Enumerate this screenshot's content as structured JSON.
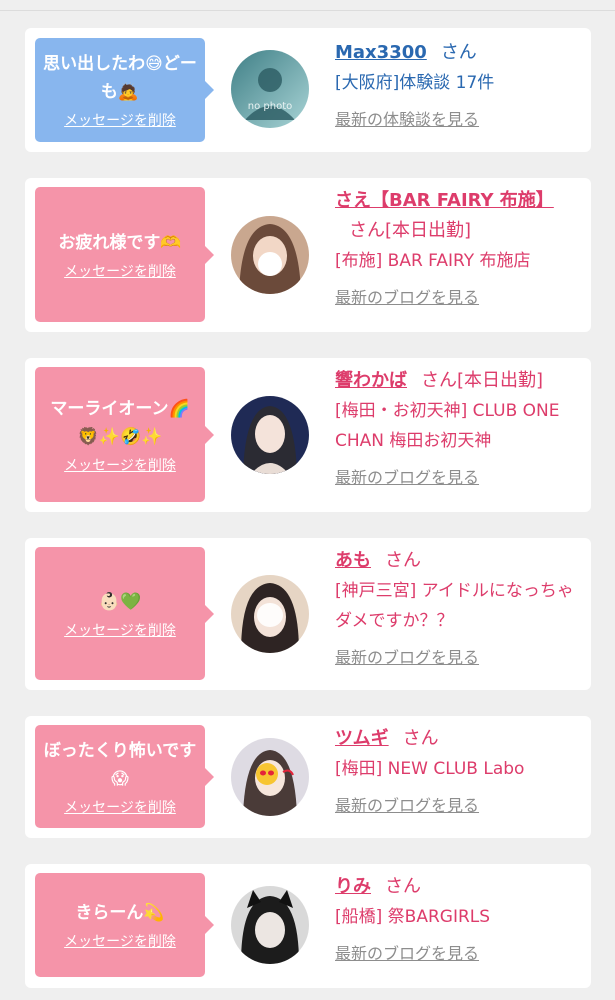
{
  "delete_label": "メッセージを削除",
  "cards": [
    {
      "message": "思い出したわ😅どーも🙇",
      "bubble_color": "#88b6ee",
      "name": "Max3300",
      "san": "さん",
      "status": "",
      "sub": "[大阪府]体験談 17件",
      "link": "最新の体験談を見る",
      "avatar_text": "no photo"
    },
    {
      "message": "お疲れ様です🫶",
      "bubble_color": "#f594a9",
      "name": "さえ【BAR FAIRY 布施】",
      "san": "さん",
      "status": "[本日出勤]",
      "sub": "[布施] BAR FAIRY 布施店",
      "link": "最新のブログを見る"
    },
    {
      "message": "マーライオーン🌈🦁✨🤣✨",
      "bubble_color": "#f594a9",
      "name": "響わかば",
      "san": "さん",
      "status": "[本日出勤]",
      "sub": "[梅田・お初天神] CLUB ONE CHAN 梅田お初天神",
      "link": "最新のブログを見る"
    },
    {
      "message": "👶🏻💚",
      "bubble_color": "#f594a9",
      "name": "あも",
      "san": "さん",
      "status": "",
      "sub": "[神戸三宮] アイドルになっちゃダメですか？？",
      "link": "最新のブログを見る"
    },
    {
      "message": "ぼったくり怖いです😱",
      "bubble_color": "#f594a9",
      "name": "ツムギ",
      "san": "さん",
      "status": "",
      "sub": "[梅田] NEW CLUB Labo",
      "link": "最新のブログを見る"
    },
    {
      "message": "きらーん💫",
      "bubble_color": "#f594a9",
      "name": "りみ",
      "san": "さん",
      "status": "",
      "sub": "[船橋] 祭BARGIRLS",
      "link": "最新のブログを見る"
    }
  ]
}
